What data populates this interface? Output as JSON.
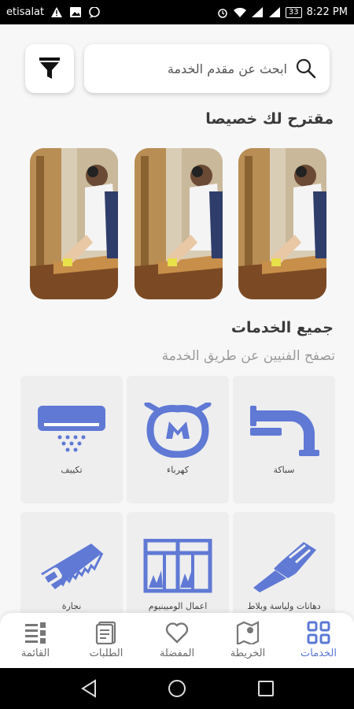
{
  "status_bar": {
    "carrier": "etisalat",
    "battery": "33",
    "time": "8:22 PM"
  },
  "search": {
    "placeholder": "ابحث عن مقدم الخدمة"
  },
  "featured": {
    "title": "مقترح لك خصيصا",
    "cards": [
      {
        "image": "carpenter-photo"
      },
      {
        "image": "carpenter-photo"
      },
      {
        "image": "carpenter-photo"
      }
    ]
  },
  "services": {
    "title": "جميع الخدمات",
    "subtitle": "تصفح الفنيين عن طريق الخدمة",
    "items": [
      {
        "label": "سباكة",
        "icon": "pipe-icon"
      },
      {
        "label": "كهرباء",
        "icon": "electric-plug-icon"
      },
      {
        "label": "تكييف",
        "icon": "air-conditioner-icon"
      },
      {
        "label": "دهانات ولياسة وبلاط",
        "icon": "paint-brush-icon"
      },
      {
        "label": "اعمال الوميينيوم",
        "icon": "window-frame-icon"
      },
      {
        "label": "نجارة",
        "icon": "saw-icon"
      }
    ]
  },
  "bottom_nav": {
    "items": [
      {
        "label": "الخدمات",
        "icon": "grid-icon",
        "active": true
      },
      {
        "label": "الخريطة",
        "icon": "map-icon",
        "active": false
      },
      {
        "label": "المفضلة",
        "icon": "heart-icon",
        "active": false
      },
      {
        "label": "الطلبات",
        "icon": "orders-icon",
        "active": false
      },
      {
        "label": "القائمة",
        "icon": "menu-list-icon",
        "active": false
      }
    ]
  },
  "colors": {
    "accent": "#5b78d6",
    "icon_blue": "#5f79d4",
    "tile_bg": "#eeeeef"
  }
}
